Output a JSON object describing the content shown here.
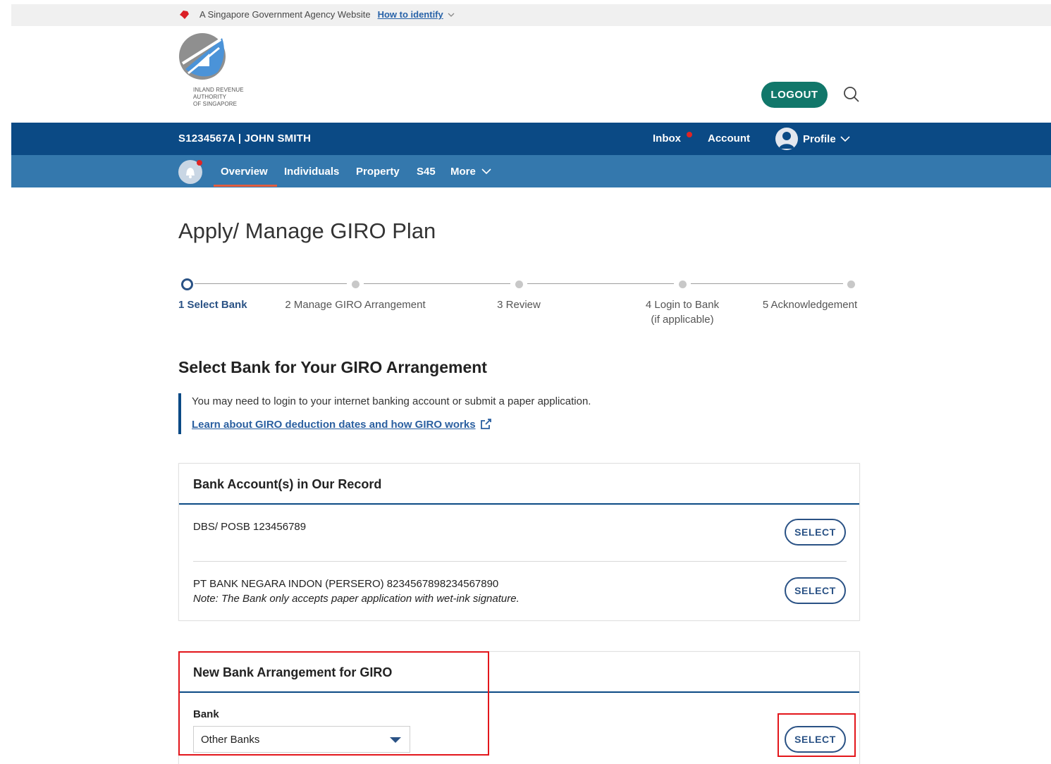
{
  "masthead": {
    "text": "A Singapore Government Agency Website",
    "link": "How to identify"
  },
  "logo": {
    "line1": "INLAND REVENUE",
    "line2": "AUTHORITY",
    "line3": "OF SINGAPORE"
  },
  "header": {
    "logout": "LOGOUT"
  },
  "nav_primary": {
    "user": "S1234567A | JOHN SMITH",
    "inbox": "Inbox",
    "account": "Account",
    "profile": "Profile"
  },
  "nav_secondary": {
    "items": [
      "Overview",
      "Individuals",
      "Property",
      "S45",
      "More"
    ]
  },
  "page": {
    "title": "Apply/ Manage GIRO Plan"
  },
  "stepper": {
    "steps": [
      {
        "label": "1 Select Bank"
      },
      {
        "label": "2 Manage GIRO Arrangement"
      },
      {
        "label": "3 Review"
      },
      {
        "label": "4 Login to Bank",
        "sub": "(if applicable)"
      },
      {
        "label": "5 Acknowledgement"
      }
    ],
    "active_step": 1
  },
  "section": {
    "heading": "Select Bank for Your GIRO Arrangement",
    "info_text": "You may need to login to your internet banking account or submit a paper application.",
    "info_link": "Learn about GIRO deduction dates and how GIRO works"
  },
  "records_card": {
    "title": "Bank Account(s) in Our Record",
    "rows": [
      {
        "account": "DBS/ POSB 123456789",
        "button": "SELECT"
      },
      {
        "account": "PT BANK NEGARA INDON (PERSERO) 8234567898234567890",
        "note": "Note: The Bank only accepts paper application with wet-ink signature.",
        "button": "SELECT"
      }
    ]
  },
  "new_card": {
    "title": "New Bank Arrangement for GIRO",
    "bank_label": "Bank",
    "bank_value": "Other Banks",
    "button": "SELECT"
  },
  "colors": {
    "primary_nav": "#0b4a85",
    "secondary_nav": "#3478ad",
    "logout_button": "#11776a",
    "highlight_box": "#e3161b"
  }
}
